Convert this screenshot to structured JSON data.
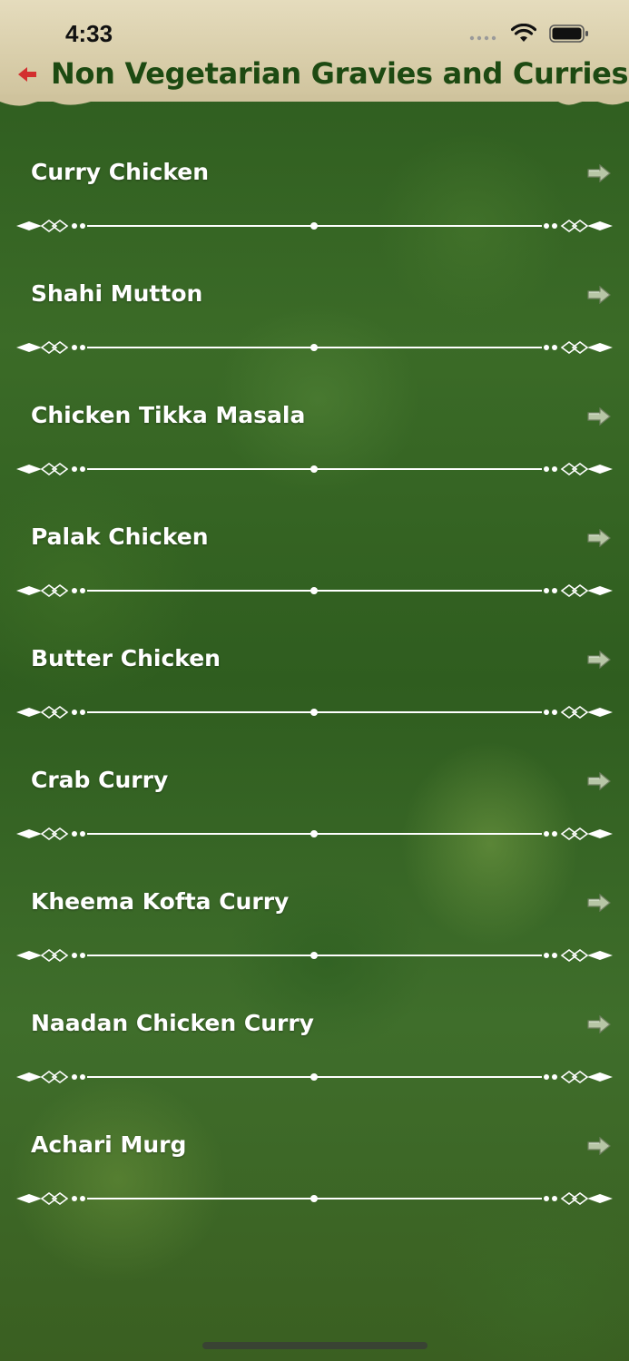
{
  "status_bar": {
    "time": "4:33"
  },
  "header": {
    "title": "Non Vegetarian Gravies and Curries",
    "back_icon": "back-arrow-icon"
  },
  "colors": {
    "header_background": "#d8cda9",
    "title_text": "#1d4a12",
    "back_arrow": "#d32f2f",
    "item_text": "#ffffff",
    "background": "#2f5d1f"
  },
  "recipes": [
    {
      "label": "Curry Chicken"
    },
    {
      "label": "Shahi Mutton"
    },
    {
      "label": "Chicken Tikka Masala"
    },
    {
      "label": "Palak Chicken"
    },
    {
      "label": "Butter Chicken"
    },
    {
      "label": "Crab Curry"
    },
    {
      "label": "Kheema Kofta Curry"
    },
    {
      "label": "Naadan Chicken Curry"
    },
    {
      "label": "Achari Murg"
    }
  ]
}
